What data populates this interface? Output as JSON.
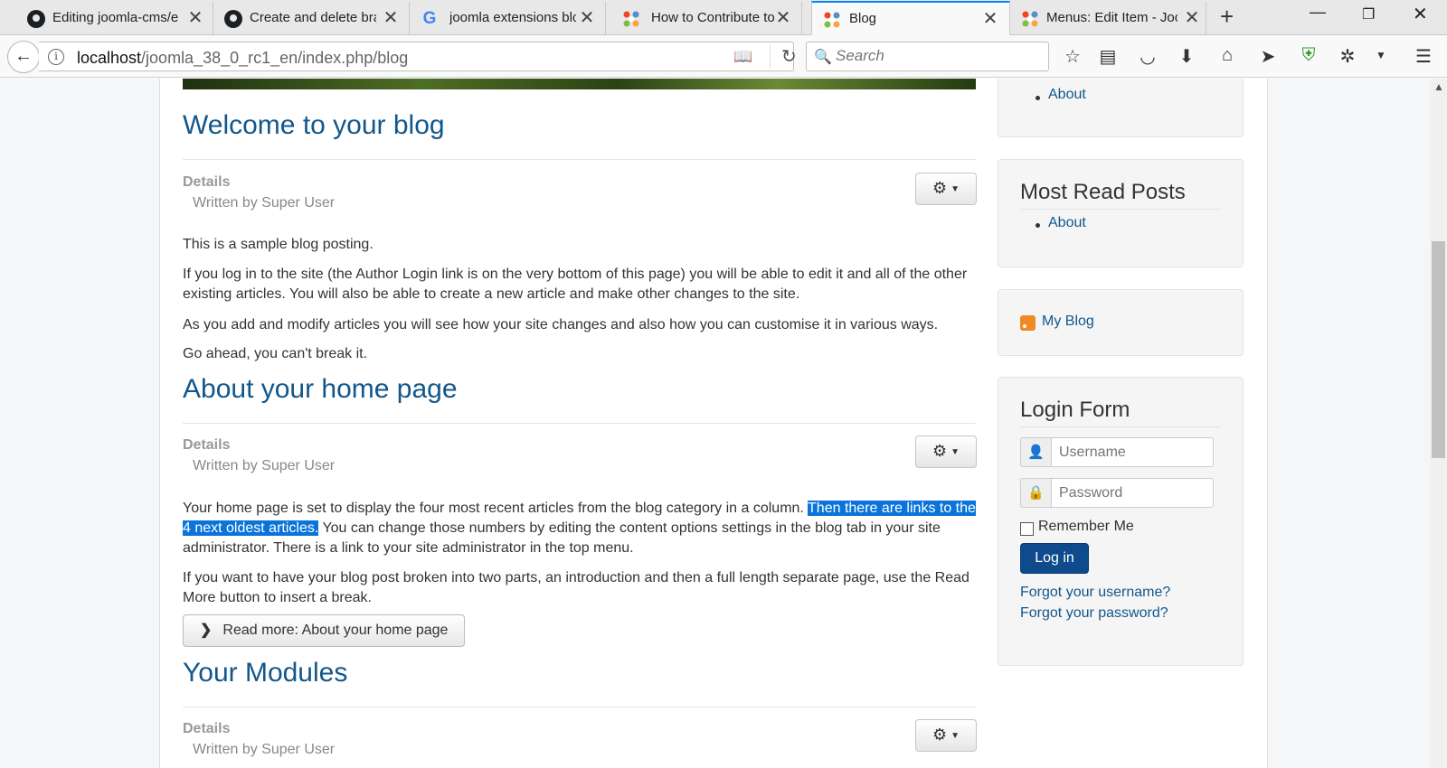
{
  "browser": {
    "tabs": [
      {
        "title": "Editing joomla-cms/e",
        "favicon": "github-icon"
      },
      {
        "title": "Create and delete bra",
        "favicon": "github-icon"
      },
      {
        "title": "joomla extensions blo",
        "favicon": "google-icon"
      },
      {
        "title": "How to Contribute to",
        "favicon": "joomla-icon"
      },
      {
        "title": "Blog",
        "favicon": "joomla-icon",
        "active": true
      },
      {
        "title": "Menus: Edit Item - Joo",
        "favicon": "joomla-icon"
      }
    ],
    "url_host": "localhost",
    "url_path": "/joomla_38_0_rc1_en/index.php/blog",
    "search_placeholder": "Search",
    "accent": "#0a84ff"
  },
  "articles": [
    {
      "title": "Welcome to your blog",
      "details_label": "Details",
      "author": "Written by Super User",
      "paragraphs": [
        "This is a sample blog posting.",
        "If you log in to the site (the Author Login link is on the very bottom of this page) you will be able to edit it and all of the other existing articles. You will also be able to create a new article and make other changes to the site.",
        "As you add and modify articles you will see how your site changes and also how you can customise it in various ways.",
        "Go ahead, you can't break it."
      ]
    },
    {
      "title": "About your home page",
      "details_label": "Details",
      "author": "Written by Super User",
      "p1_before": "Your home page is set to display the four most recent articles from the blog category in a column. ",
      "p1_highlight": "Then there are links to the 4 next oldest articles.",
      "p1_after": " You can change those numbers by editing the content options settings in the blog tab in your site administrator. There is a link to your site administrator in the top menu.",
      "p2": "If you want to have your blog post broken into two parts, an introduction and then a full length separate page, use the Read More button to insert a break.",
      "read_more": "Read more: About your home page"
    },
    {
      "title": "Your Modules",
      "details_label": "Details",
      "author": "Written by Super User"
    }
  ],
  "sidebar": {
    "top_link": "About",
    "most_read_title": "Most Read Posts",
    "most_read_link": "About",
    "feed_link": "My Blog",
    "login_title": "Login Form",
    "username_placeholder": "Username",
    "password_placeholder": "Password",
    "remember_label": "Remember Me",
    "login_button": "Log in",
    "forgot_username": "Forgot your username?",
    "forgot_password": "Forgot your password?"
  },
  "colors": {
    "heading": "#12578b",
    "selection": "#0a74da",
    "login_button": "#0e4a8c"
  }
}
